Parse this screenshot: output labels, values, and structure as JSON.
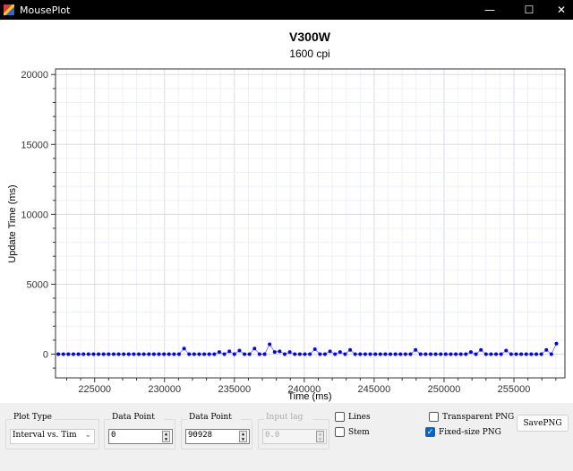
{
  "window": {
    "title": "MousePlot",
    "minimize": "—",
    "maximize": "☐",
    "close": "✕"
  },
  "chart_data": {
    "type": "scatter",
    "title": "V300W",
    "subtitle": "1600 cpi",
    "xlabel": "Time (ms)",
    "ylabel": "Update Time (ms)",
    "xlim": [
      222200,
      258650
    ],
    "ylim": [
      -1700,
      20400
    ],
    "xticks": [
      225000,
      230000,
      235000,
      240000,
      245000,
      250000,
      255000
    ],
    "yticks": [
      0,
      5000,
      10000,
      15000,
      20000
    ],
    "grid": true,
    "color": "#0000ff",
    "x_start": 222400,
    "x_step": 360,
    "values": [
      0,
      0,
      0,
      0,
      0,
      0,
      0,
      0,
      0,
      0,
      0,
      0,
      0,
      0,
      0,
      0,
      0,
      0,
      0,
      0,
      0,
      0,
      0,
      0,
      0,
      400,
      0,
      0,
      0,
      0,
      0,
      0,
      150,
      0,
      200,
      0,
      250,
      0,
      0,
      400,
      0,
      0,
      700,
      150,
      200,
      0,
      150,
      0,
      0,
      0,
      0,
      350,
      0,
      0,
      200,
      0,
      150,
      0,
      300,
      0,
      0,
      0,
      0,
      0,
      0,
      0,
      0,
      0,
      0,
      0,
      0,
      300,
      0,
      0,
      0,
      0,
      0,
      0,
      0,
      0,
      0,
      0,
      150,
      0,
      300,
      0,
      0,
      0,
      0,
      250,
      0,
      0,
      0,
      0,
      0,
      0,
      0,
      300,
      0,
      750
    ]
  },
  "controls": {
    "plot_type_label": "Plot Type",
    "plot_type_value": "Interval vs. Tim",
    "start_label": "Data Point Start",
    "start_value": "0",
    "end_label": "Data Point End",
    "end_value": "90928",
    "lag_label": "Input lag delay",
    "lag_value": "0.0",
    "lines_label": "Lines",
    "stem_label": "Stem",
    "transparent_label": "Transparent PNG",
    "fixed_label": "Fixed-size PNG",
    "save_label": "SavePNG"
  }
}
